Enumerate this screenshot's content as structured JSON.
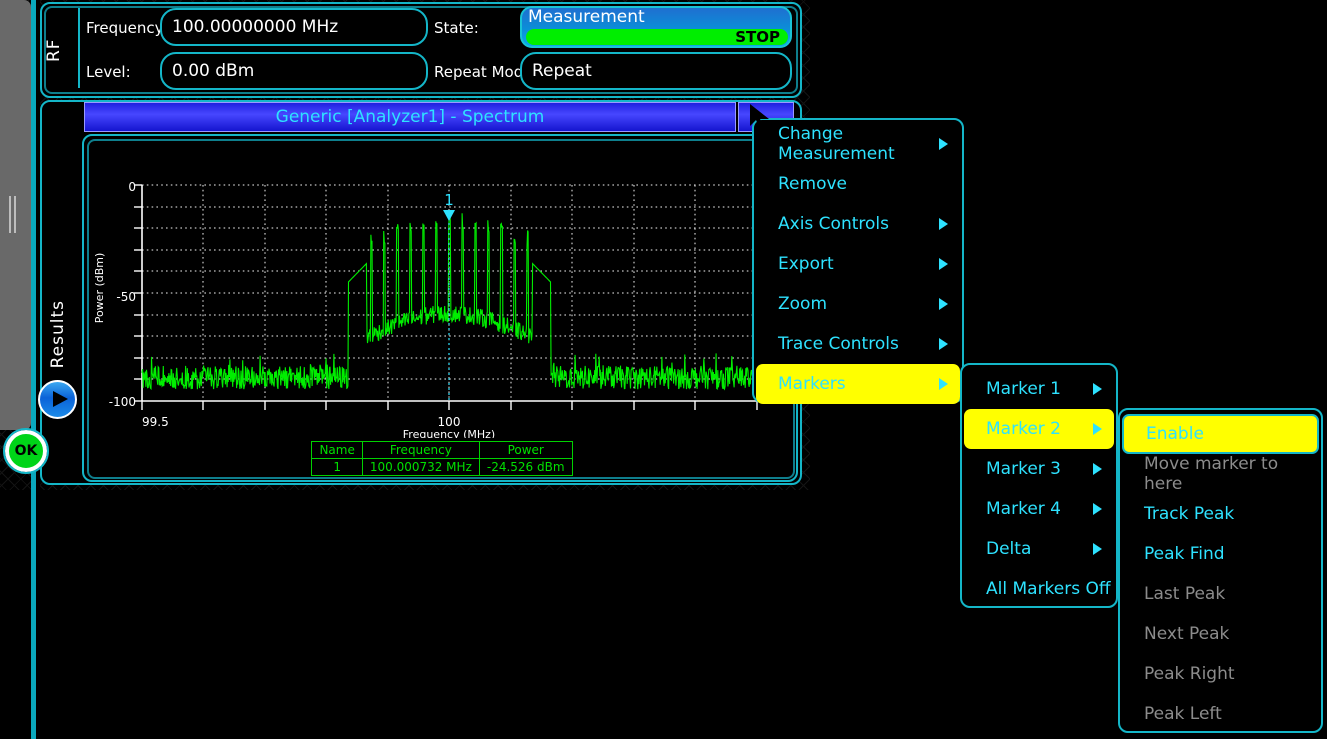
{
  "rf_panel": {
    "section_label": "RF",
    "frequency_label": "Frequency:",
    "frequency_value": "100.00000000 MHz",
    "level_label": "Level:",
    "level_value": "0.00 dBm",
    "state_label": "State:",
    "measurement_title": "Measurement",
    "measurement_state": "STOP",
    "repeat_mode_label": "Repeat Mode:",
    "repeat_mode_value": "Repeat"
  },
  "results_panel": {
    "section_label": "Results",
    "play_icon": "play-icon",
    "ok_button": "OK"
  },
  "chart_window": {
    "title": "Generic [Analyzer1] -  Spectrum",
    "menu_button_icon": "window-menu-icon"
  },
  "marker_table": {
    "headers": [
      "Name",
      "Frequency",
      "Power"
    ],
    "rows": [
      [
        "1",
        "100.000732 MHz",
        "-24.526 dBm"
      ]
    ]
  },
  "context_menu": {
    "items": [
      {
        "label": "Change Measurement",
        "submenu": true,
        "enabled": true,
        "highlighted": false
      },
      {
        "label": "Remove",
        "submenu": false,
        "enabled": true,
        "highlighted": false
      },
      {
        "label": "Axis Controls",
        "submenu": true,
        "enabled": true,
        "highlighted": false
      },
      {
        "label": "Export",
        "submenu": true,
        "enabled": true,
        "highlighted": false
      },
      {
        "label": "Zoom",
        "submenu": true,
        "enabled": true,
        "highlighted": false
      },
      {
        "label": "Trace Controls",
        "submenu": true,
        "enabled": true,
        "highlighted": false
      },
      {
        "label": "Markers",
        "submenu": true,
        "enabled": true,
        "highlighted": true
      }
    ]
  },
  "markers_submenu": {
    "items": [
      {
        "label": "Marker 1",
        "submenu": true,
        "enabled": true,
        "highlighted": false
      },
      {
        "label": "Marker 2",
        "submenu": true,
        "enabled": true,
        "highlighted": true
      },
      {
        "label": "Marker 3",
        "submenu": true,
        "enabled": true,
        "highlighted": false
      },
      {
        "label": "Marker 4",
        "submenu": true,
        "enabled": true,
        "highlighted": false
      },
      {
        "label": "Delta",
        "submenu": true,
        "enabled": true,
        "highlighted": false
      },
      {
        "label": "All Markers Off",
        "submenu": false,
        "enabled": true,
        "highlighted": false
      }
    ]
  },
  "marker2_submenu": {
    "items": [
      {
        "label": "Enable",
        "enabled": true,
        "highlighted": true
      },
      {
        "label": "Move marker to here",
        "enabled": false,
        "highlighted": false
      },
      {
        "label": "Track Peak",
        "enabled": true,
        "highlighted": false
      },
      {
        "label": "Peak Find",
        "enabled": true,
        "highlighted": false
      },
      {
        "label": "Last Peak",
        "enabled": false,
        "highlighted": false
      },
      {
        "label": "Next Peak",
        "enabled": false,
        "highlighted": false
      },
      {
        "label": "Peak Right",
        "enabled": false,
        "highlighted": false
      },
      {
        "label": "Peak Left",
        "enabled": false,
        "highlighted": false
      }
    ]
  },
  "colors": {
    "accent_cyan": "#2ee2ff",
    "border_cyan": "#14b6c8",
    "highlight_yellow": "#ffff00",
    "trace_green": "#00ee00",
    "disabled_gray": "#8c8c8c",
    "title_blue": "#2020e0"
  },
  "chart_data": {
    "type": "line",
    "title": "",
    "xlabel": "Frequency (MHz)",
    "ylabel": "Power (dBm)",
    "xlim": [
      99.5,
      100.5
    ],
    "ylim": [
      -110,
      0
    ],
    "xticks": [
      99.5,
      100
    ],
    "xticklabels": [
      "99.5",
      "100"
    ],
    "yticks": [
      0,
      -50,
      -100
    ],
    "yticklabels": [
      "0",
      "-50",
      "-100"
    ],
    "grid": true,
    "series": [
      {
        "name": "Spectrum",
        "color": "#00ee00",
        "description": "Modulated carrier spectrum centered at 100 MHz with comb of tones over a noise floor near -100 dBm",
        "noise_floor_dbm": -100,
        "carrier_center_mhz": 100,
        "carrier_peak_dbm": -12,
        "occupied_bandwidth_mhz": 0.26
      }
    ],
    "markers": [
      {
        "name": "1",
        "frequency_mhz": 100.000732,
        "power_dbm": -24.526,
        "label": "1",
        "color": "#2ee2ff"
      }
    ]
  }
}
